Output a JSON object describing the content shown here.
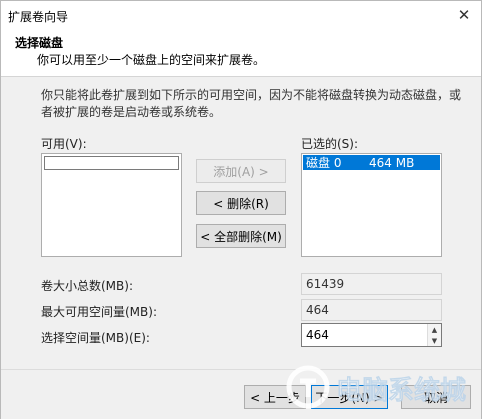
{
  "window": {
    "title": "扩展卷向导"
  },
  "header": {
    "title": "选择磁盘",
    "subtitle": "你可以用至少一个磁盘上的空间来扩展卷。"
  },
  "description": "你只能将此卷扩展到如下所示的可用空间，因为不能将磁盘转换为动态磁盘，或者被扩展的卷是启动卷或系统卷。",
  "available": {
    "label": "可用(V):"
  },
  "selected": {
    "label": "已选的(S):",
    "items": [
      {
        "disk": "磁盘 0",
        "size": "464 MB"
      }
    ]
  },
  "buttons": {
    "add": "添加(A) >",
    "remove": "< 删除(R)",
    "remove_all": "< 全部删除(M)"
  },
  "fields": {
    "total_size_label": "卷大小总数(MB):",
    "total_size_value": "61439",
    "max_space_label": "最大可用空间量(MB):",
    "max_space_value": "464",
    "select_space_label": "选择空间量(MB)(E):",
    "select_space_value": "464"
  },
  "footer": {
    "back": "< 上一步",
    "next": "下一步(N) >",
    "cancel": "取消"
  },
  "watermark": {
    "text": "电脑系统城"
  }
}
